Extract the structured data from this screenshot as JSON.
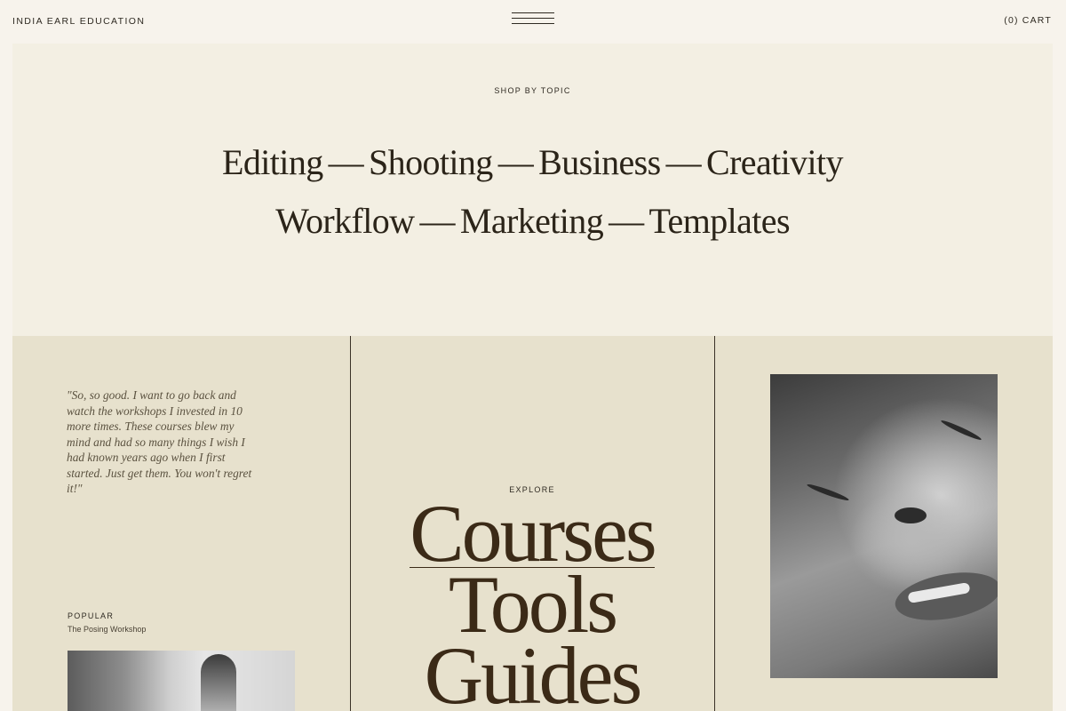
{
  "header": {
    "brand": "INDIA EARL EDUCATION",
    "menu_icon": "hamburger-menu-icon",
    "cart_label": "(0) CART"
  },
  "topics": {
    "label": "SHOP BY TOPIC",
    "row1": [
      "Editing",
      "Shooting",
      "Business",
      "Creativity"
    ],
    "row2": [
      "Workflow",
      "Marketing",
      "Templates"
    ],
    "separator": "—"
  },
  "testimonial": {
    "quote": "\"So, so good. I want to go back and watch the workshops I invested in 10 more times. These courses blew my mind and had so many things I wish I had known years ago when I first started. Just get them. You won't regret it!\""
  },
  "popular": {
    "label": "POPULAR",
    "title": "The Posing Workshop"
  },
  "explore": {
    "label": "EXPLORE",
    "items": [
      "Courses",
      "Tools",
      "Guides"
    ]
  },
  "colors": {
    "background": "#f7f3ec",
    "topics_bg": "#f3efe3",
    "lower_bg": "#e7e1cd",
    "text_dark": "#2f2a22",
    "explore_brown": "#3b2a17"
  }
}
